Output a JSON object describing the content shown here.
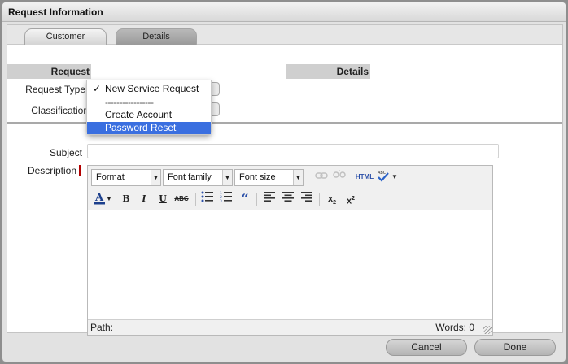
{
  "window": {
    "title": "Request Information"
  },
  "tabs": [
    {
      "label": "Customer"
    },
    {
      "label": "Details"
    }
  ],
  "sections": {
    "request": "Request",
    "details": "Details"
  },
  "form": {
    "request_type_label": "Request Type",
    "classification_label": "Classification",
    "subject_label": "Subject",
    "subject_value": "",
    "description_label": "Description"
  },
  "dropdown": {
    "items": [
      {
        "label": "New Service Request",
        "checked": true
      },
      {
        "label": "-----------------"
      },
      {
        "label": "Create Account"
      },
      {
        "label": "Password Reset",
        "highlighted": true
      }
    ],
    "check_glyph": "✓"
  },
  "editor": {
    "format_select": "Format",
    "font_family_select": "Font family",
    "font_size_select": "Font size",
    "html_button": "HTML",
    "path_label": "Path:",
    "words_label": "Words: 0"
  },
  "buttons": {
    "cancel": "Cancel",
    "done": "Done"
  },
  "colors": {
    "highlight": "#3a6fe0",
    "required_marker": "#b30000"
  }
}
